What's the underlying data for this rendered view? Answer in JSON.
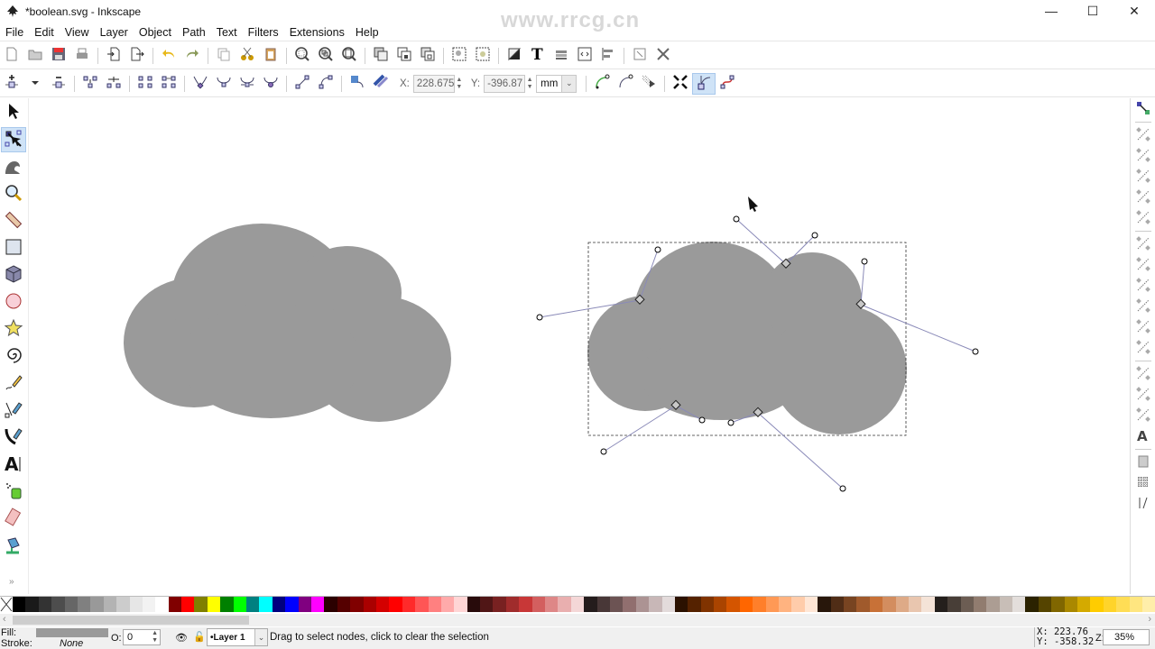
{
  "window": {
    "title": "*boolean.svg - Inkscape",
    "watermark": "www.rrcg.cn",
    "minimize": "—",
    "maximize": "☐",
    "close": "✕"
  },
  "menu": [
    {
      "label": "File",
      "accel": "F"
    },
    {
      "label": "Edit",
      "accel": "E"
    },
    {
      "label": "View",
      "accel": "V"
    },
    {
      "label": "Layer",
      "accel": "L"
    },
    {
      "label": "Object",
      "accel": "O"
    },
    {
      "label": "Path",
      "accel": "P"
    },
    {
      "label": "Text",
      "accel": "T"
    },
    {
      "label": "Filters",
      "accel": "s"
    },
    {
      "label": "Extensions",
      "accel": "n"
    },
    {
      "label": "Help",
      "accel": "H"
    }
  ],
  "commands_bar": [
    "new-document-icon",
    "open-icon",
    "save-icon",
    "print-icon",
    "|",
    "import-icon",
    "export-icon",
    "|",
    "undo-icon",
    "redo-icon",
    "|",
    "copy-icon",
    "cut-icon",
    "paste-icon",
    "|",
    "zoom-selection-icon",
    "zoom-drawing-icon",
    "zoom-page-icon",
    "|",
    "duplicate-icon",
    "clone-icon",
    "unlink-clone-icon",
    "|",
    "group-icon",
    "ungroup-icon",
    "|",
    "fill-stroke-icon",
    "text-font-icon",
    "layers-icon",
    "xml-editor-icon",
    "align-distribute-icon",
    "|",
    "document-properties-icon",
    "preferences-icon"
  ],
  "node_toolbar": {
    "buttons_left": [
      "insert-node-icon",
      "insert-node-dropdown-icon",
      "delete-node-icon",
      "|",
      "join-nodes-icon",
      "break-path-icon",
      "|",
      "join-segment-icon",
      "delete-segment-icon",
      "|",
      "cusp-node-icon",
      "smooth-node-icon",
      "symmetric-node-icon",
      "auto-smooth-node-icon",
      "|",
      "segment-to-line-icon",
      "segment-to-curve-icon",
      "|",
      "object-to-path-icon",
      "stroke-to-path-icon"
    ],
    "x_label": "X:",
    "x_value": "228.675",
    "y_label": "Y:",
    "y_value": "-396.87",
    "unit": "mm",
    "buttons_right": [
      "next-path-effect-param-icon",
      "show-clipping-path-icon",
      "show-mask-icon",
      "|",
      "show-transform-handles-icon",
      "show-bezier-handles-icon",
      "show-path-outline-icon"
    ],
    "active_right": "show-bezier-handles-icon"
  },
  "tools": [
    {
      "name": "selector-tool",
      "active": false
    },
    {
      "name": "node-tool",
      "active": true
    },
    {
      "name": "tweak-tool",
      "active": false
    },
    {
      "name": "zoom-tool",
      "active": false
    },
    {
      "name": "measure-tool",
      "active": false
    },
    {
      "name": "rectangle-tool",
      "active": false
    },
    {
      "name": "3d-box-tool",
      "active": false
    },
    {
      "name": "ellipse-tool",
      "active": false
    },
    {
      "name": "star-tool",
      "active": false
    },
    {
      "name": "spiral-tool",
      "active": false
    },
    {
      "name": "pencil-tool",
      "active": false
    },
    {
      "name": "pen-tool",
      "active": false
    },
    {
      "name": "calligraphy-tool",
      "active": false
    },
    {
      "name": "text-tool",
      "active": false
    },
    {
      "name": "spray-tool",
      "active": false
    },
    {
      "name": "eraser-tool",
      "active": false
    },
    {
      "name": "paint-bucket-tool",
      "active": false
    }
  ],
  "tools_more": "»",
  "snap_bar": [
    "snap-toggle-icon",
    "|",
    "snap-bbox-icon",
    "snap-bbox-edge-icon",
    "snap-bbox-corner-icon",
    "snap-bbox-edge-mid-icon",
    "snap-bbox-center-icon",
    "|",
    "snap-nodes-icon",
    "snap-path-icon",
    "snap-path-intersection-icon",
    "snap-cusp-icon",
    "snap-smooth-icon",
    "snap-midpoint-icon",
    "|",
    "snap-others-icon",
    "snap-object-center-icon",
    "snap-rotation-center-icon",
    "snap-text-baseline-icon",
    "|",
    "snap-page-border-icon",
    "snap-grid-icon",
    "snap-guide-icon"
  ],
  "canvas": {
    "shape_fill": "#9a9a9a",
    "handle_line_color": "#8a8ab8",
    "cursor": "arrow"
  },
  "palette": [
    "#000000",
    "#1a1a1a",
    "#333333",
    "#4d4d4d",
    "#666666",
    "#808080",
    "#999999",
    "#b3b3b3",
    "#cccccc",
    "#e6e6e6",
    "#f2f2f2",
    "#ffffff",
    "#800000",
    "#ff0000",
    "#808000",
    "#ffff00",
    "#008000",
    "#00ff00",
    "#008080",
    "#00ffff",
    "#000080",
    "#0000ff",
    "#800080",
    "#ff00ff",
    "#2b0000",
    "#550000",
    "#800000",
    "#aa0000",
    "#d40000",
    "#ff0000",
    "#ff2a2a",
    "#ff5555",
    "#ff8080",
    "#ffaaaa",
    "#ffd5d5",
    "#280b0b",
    "#501616",
    "#782121",
    "#a02c2c",
    "#c83737",
    "#d35f5f",
    "#de8787",
    "#e9afaf",
    "#f4d7d7",
    "#241c1c",
    "#483737",
    "#6c5353",
    "#916f6f",
    "#ac9393",
    "#c8b7b7",
    "#e3dbdb",
    "#2b1100",
    "#552200",
    "#803300",
    "#aa4400",
    "#d45500",
    "#ff6600",
    "#ff7f2a",
    "#ff9955",
    "#ffb380",
    "#ffccaa",
    "#ffe6d5",
    "#28170b",
    "#502d16",
    "#784421",
    "#a05a2c",
    "#c87137",
    "#d38d5f",
    "#deaa87",
    "#e9c6af",
    "#f4e3d7",
    "#241f1c",
    "#483e37",
    "#6c5d53",
    "#917c6f",
    "#ac9d93",
    "#c8beb7",
    "#e3dedb",
    "#2b2200",
    "#554400",
    "#806600",
    "#aa8800",
    "#d4aa00",
    "#ffcc00",
    "#ffd42a",
    "#ffdd55",
    "#ffe680",
    "#ffeeaa"
  ],
  "status": {
    "fill_label": "Fill:",
    "stroke_label": "Stroke:",
    "stroke_value": "None",
    "opacity_label": "O:",
    "opacity_value": "0",
    "layer": "•Layer 1",
    "message": "Drag to select nodes, click to clear the selection",
    "cursor_x_label": "X:",
    "cursor_x": "223.76",
    "cursor_y_label": "Y:",
    "cursor_y": "-358.32",
    "zoom_label": "Z:",
    "zoom": "35%"
  }
}
